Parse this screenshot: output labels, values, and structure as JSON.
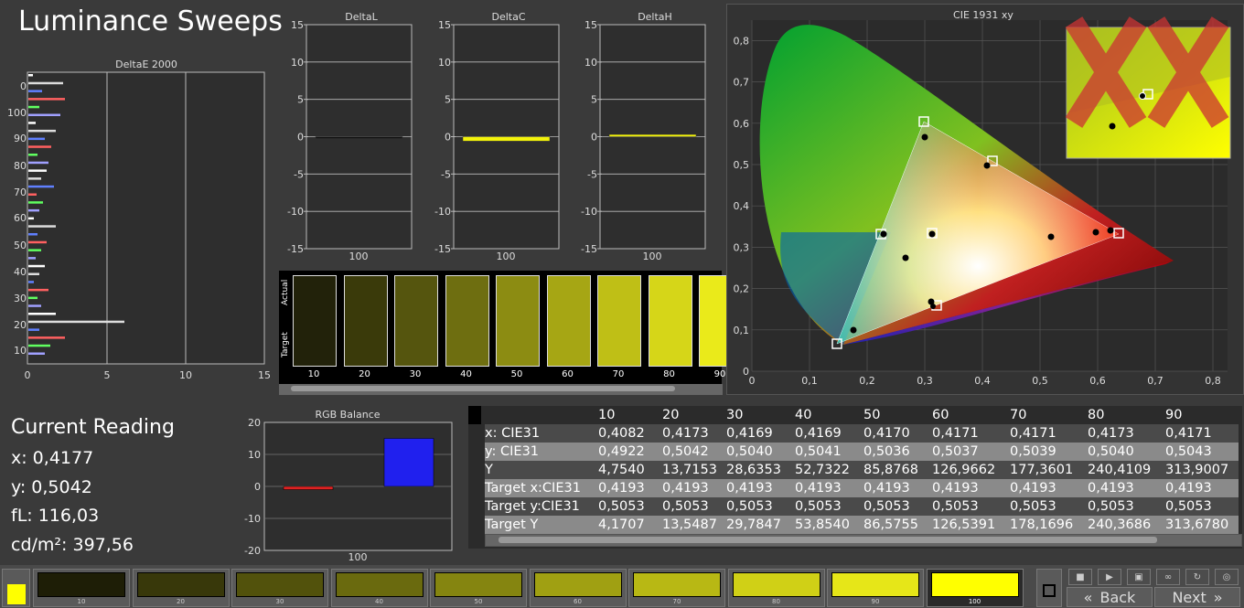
{
  "app": {
    "title": "Luminance Sweeps"
  },
  "deltae": {
    "title": "DeltaE 2000",
    "x_ticks": [
      "0",
      "5",
      "10",
      "15"
    ],
    "y_ticks": [
      "0",
      "100",
      "90",
      "80",
      "70",
      "60",
      "50",
      "40",
      "30",
      "20",
      "10"
    ]
  },
  "delta_panels": [
    {
      "title": "DeltaL",
      "x_label": "100",
      "y_ticks": [
        "15",
        "10",
        "5",
        "0",
        "-5",
        "-10",
        "-15"
      ],
      "value": 0.0,
      "color": "#111111"
    },
    {
      "title": "DeltaC",
      "x_label": "100",
      "y_ticks": [
        "15",
        "10",
        "5",
        "0",
        "-5",
        "-10",
        "-15"
      ],
      "value": -0.6,
      "color": "#f2f20a"
    },
    {
      "title": "DeltaH",
      "x_label": "100",
      "y_ticks": [
        "15",
        "10",
        "5",
        "0",
        "-5",
        "-10",
        "-15"
      ],
      "value": 0.3,
      "color": "#f2f20a"
    }
  ],
  "comparison": {
    "actual_label": "Actual",
    "target_label": "Target",
    "labels": [
      "10",
      "20",
      "30",
      "40",
      "50",
      "60",
      "70",
      "80",
      "90"
    ],
    "colors": [
      "#22220a",
      "#3a3a0a",
      "#55550e",
      "#6e6e10",
      "#8c8c12",
      "#a6a614",
      "#bfbf16",
      "#d6d618",
      "#eaea1a"
    ]
  },
  "cie": {
    "title": "CIE 1931 xy",
    "x_ticks": [
      "0",
      "0,1",
      "0,2",
      "0,3",
      "0,4",
      "0,5",
      "0,6",
      "0,7",
      "0,8"
    ],
    "y_ticks": [
      "0",
      "0,1",
      "0,2",
      "0,3",
      "0,4",
      "0,5",
      "0,6",
      "0,7",
      "0,8"
    ]
  },
  "reading": {
    "title": "Current Reading",
    "x": "x: 0,4177",
    "y": "y: 0,5042",
    "fl": "fL: 116,03",
    "cdm2": "cd/m²: 397,56"
  },
  "rgb_balance": {
    "title": "RGB Balance",
    "y_ticks": [
      "20",
      "10",
      "0",
      "-10",
      "-20"
    ],
    "x_label": "100",
    "red": -1,
    "green": 0,
    "blue": 15
  },
  "table": {
    "columns": [
      "",
      "10",
      "20",
      "30",
      "40",
      "50",
      "60",
      "70",
      "80",
      "90"
    ],
    "rows": [
      [
        "x: CIE31",
        "0,4082",
        "0,4173",
        "0,4169",
        "0,4169",
        "0,4170",
        "0,4171",
        "0,4171",
        "0,4173",
        "0,4171"
      ],
      [
        "y: CIE31",
        "0,4922",
        "0,5042",
        "0,5040",
        "0,5041",
        "0,5036",
        "0,5037",
        "0,5039",
        "0,5040",
        "0,5043"
      ],
      [
        "Y",
        "4,7540",
        "13,7153",
        "28,6353",
        "52,7322",
        "85,8768",
        "126,9662",
        "177,3601",
        "240,4109",
        "313,9007"
      ],
      [
        "Target x:CIE31",
        "0,4193",
        "0,4193",
        "0,4193",
        "0,4193",
        "0,4193",
        "0,4193",
        "0,4193",
        "0,4193",
        "0,4193"
      ],
      [
        "Target y:CIE31",
        "0,5053",
        "0,5053",
        "0,5053",
        "0,5053",
        "0,5053",
        "0,5053",
        "0,5053",
        "0,5053",
        "0,5053"
      ],
      [
        "Target Y",
        "4,1707",
        "13,5487",
        "29,7847",
        "53,8540",
        "86,5755",
        "126,5391",
        "178,1696",
        "240,3686",
        "313,6780"
      ]
    ]
  },
  "swatches": [
    {
      "label": "10",
      "color": "#1e1e06"
    },
    {
      "label": "20",
      "color": "#38380a"
    },
    {
      "label": "30",
      "color": "#52520c"
    },
    {
      "label": "40",
      "color": "#6a6a0e"
    },
    {
      "label": "50",
      "color": "#858510"
    },
    {
      "label": "60",
      "color": "#a0a012"
    },
    {
      "label": "70",
      "color": "#b8b814"
    },
    {
      "label": "80",
      "color": "#d0d016"
    },
    {
      "label": "90",
      "color": "#e6e618"
    },
    {
      "label": "100",
      "color": "#ffff00"
    }
  ],
  "nav": {
    "back": "Back",
    "next": "Next"
  },
  "colors": {
    "accent_yellow": "#ffff00",
    "panel_bg": "#2e2e2e",
    "grid": "#bbbbbb"
  }
}
